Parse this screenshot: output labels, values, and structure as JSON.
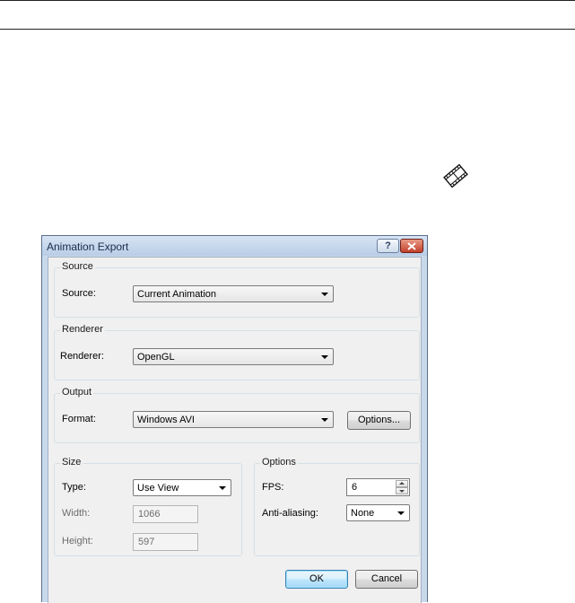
{
  "dialog": {
    "title": "Animation Export",
    "help_label": "?"
  },
  "source_group": {
    "title": "Source",
    "label": "Source:",
    "value": "Current Animation"
  },
  "renderer_group": {
    "title": "Renderer",
    "label": "Renderer:",
    "value": "OpenGL"
  },
  "output_group": {
    "title": "Output",
    "label": "Format:",
    "value": "Windows AVI",
    "options_button": "Options..."
  },
  "size_group": {
    "title": "Size",
    "type_label": "Type:",
    "type_value": "Use View",
    "width_label": "Width:",
    "width_value": "1066",
    "height_label": "Height:",
    "height_value": "597"
  },
  "options_group": {
    "title": "Options",
    "fps_label": "FPS:",
    "fps_value": "6",
    "aa_label": "Anti-aliasing:",
    "aa_value": "None"
  },
  "buttons": {
    "ok": "OK",
    "cancel": "Cancel"
  },
  "icons": {
    "toolbar_icon": "film-strip-icon",
    "close": "close-icon"
  }
}
